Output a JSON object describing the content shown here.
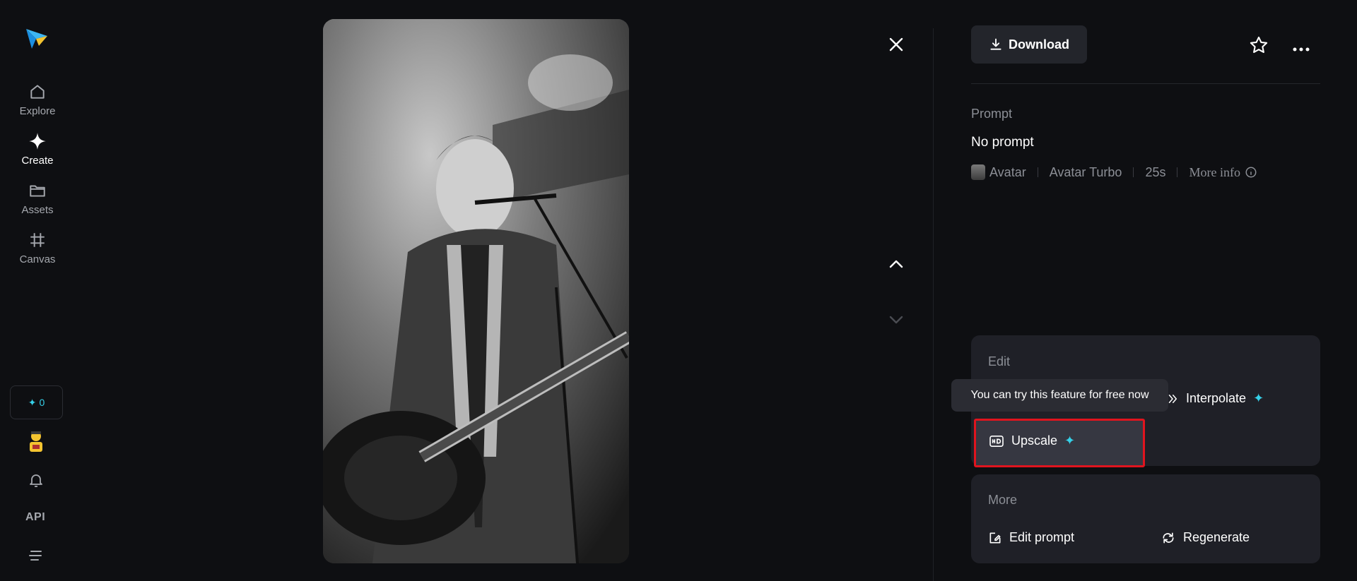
{
  "sidebar": {
    "items": [
      {
        "label": "Explore",
        "icon": "home-icon"
      },
      {
        "label": "Create",
        "icon": "sparkle-icon"
      },
      {
        "label": "Assets",
        "icon": "folder-icon"
      },
      {
        "label": "Canvas",
        "icon": "crop-icon"
      }
    ],
    "credits": "0",
    "api_label": "API"
  },
  "toolbar": {
    "download_label": "Download"
  },
  "details": {
    "prompt_label": "Prompt",
    "prompt_value": "No prompt",
    "model_family": "Avatar",
    "model_name": "Avatar Turbo",
    "duration": "25s",
    "more_info": "More info"
  },
  "edit_panel": {
    "title": "Edit",
    "interpolate_label": "Interpolate",
    "upscale_label": "Upscale",
    "tooltip": "You can try this feature for free now"
  },
  "more_panel": {
    "title": "More",
    "edit_prompt_label": "Edit prompt",
    "regenerate_label": "Regenerate"
  },
  "colors": {
    "background": "#0e0f12",
    "card": "#1f2027",
    "accent": "#35d0e8",
    "highlight": "#e0141e"
  }
}
